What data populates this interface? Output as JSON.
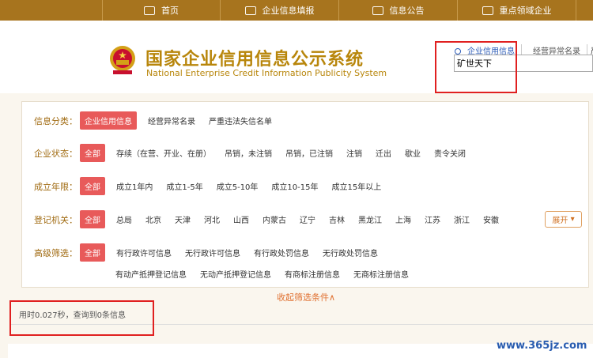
{
  "nav": {
    "items": [
      {
        "label": "首页"
      },
      {
        "label": "企业信息填报"
      },
      {
        "label": "信息公告"
      },
      {
        "label": "重点领域企业"
      }
    ]
  },
  "header": {
    "title_cn": "国家企业信用信息公示系统",
    "title_en": "National Enterprise Credit Information Publicity System"
  },
  "search": {
    "tabs": [
      {
        "label": "企业信用信息",
        "active": true
      },
      {
        "label": "经营异常名录"
      },
      {
        "label": "严"
      }
    ],
    "value": "矿世天下"
  },
  "filters": {
    "category": {
      "label": "信息分类：",
      "selected": "企业信用信息",
      "options": [
        "经营异常名录",
        "严重违法失信名单"
      ]
    },
    "status": {
      "label": "企业状态：",
      "selected": "全部",
      "options": [
        "存续（在营、开业、在册）",
        "吊销，未注销",
        "吊销，已注销",
        "注销",
        "迁出",
        "歇业",
        "责令关闭"
      ]
    },
    "age": {
      "label": "成立年限：",
      "selected": "全部",
      "options": [
        "成立1年内",
        "成立1-5年",
        "成立5-10年",
        "成立10-15年",
        "成立15年以上"
      ]
    },
    "authority": {
      "label": "登记机关：",
      "selected": "全部",
      "options": [
        "总局",
        "北京",
        "天津",
        "河北",
        "山西",
        "内蒙古",
        "辽宁",
        "吉林",
        "黑龙江",
        "上海",
        "江苏",
        "浙江",
        "安徽"
      ],
      "expand": "展开"
    },
    "advanced": {
      "label": "高级筛选：",
      "selected": "全部",
      "options_row1": [
        "有行政许可信息",
        "无行政许可信息",
        "有行政处罚信息",
        "无行政处罚信息"
      ],
      "options_row2": [
        "有动产抵押登记信息",
        "无动产抵押登记信息",
        "有商标注册信息",
        "无商标注册信息"
      ]
    },
    "collapse": "收起筛选条件∧"
  },
  "result": {
    "text": "用时0.027秒，查询到0条信息"
  },
  "watermark": "www.365jz.com",
  "colors": {
    "nav": "#a7741e",
    "accent": "#e85a5a",
    "title": "#b8860b",
    "highlight_box": "#e02020"
  }
}
